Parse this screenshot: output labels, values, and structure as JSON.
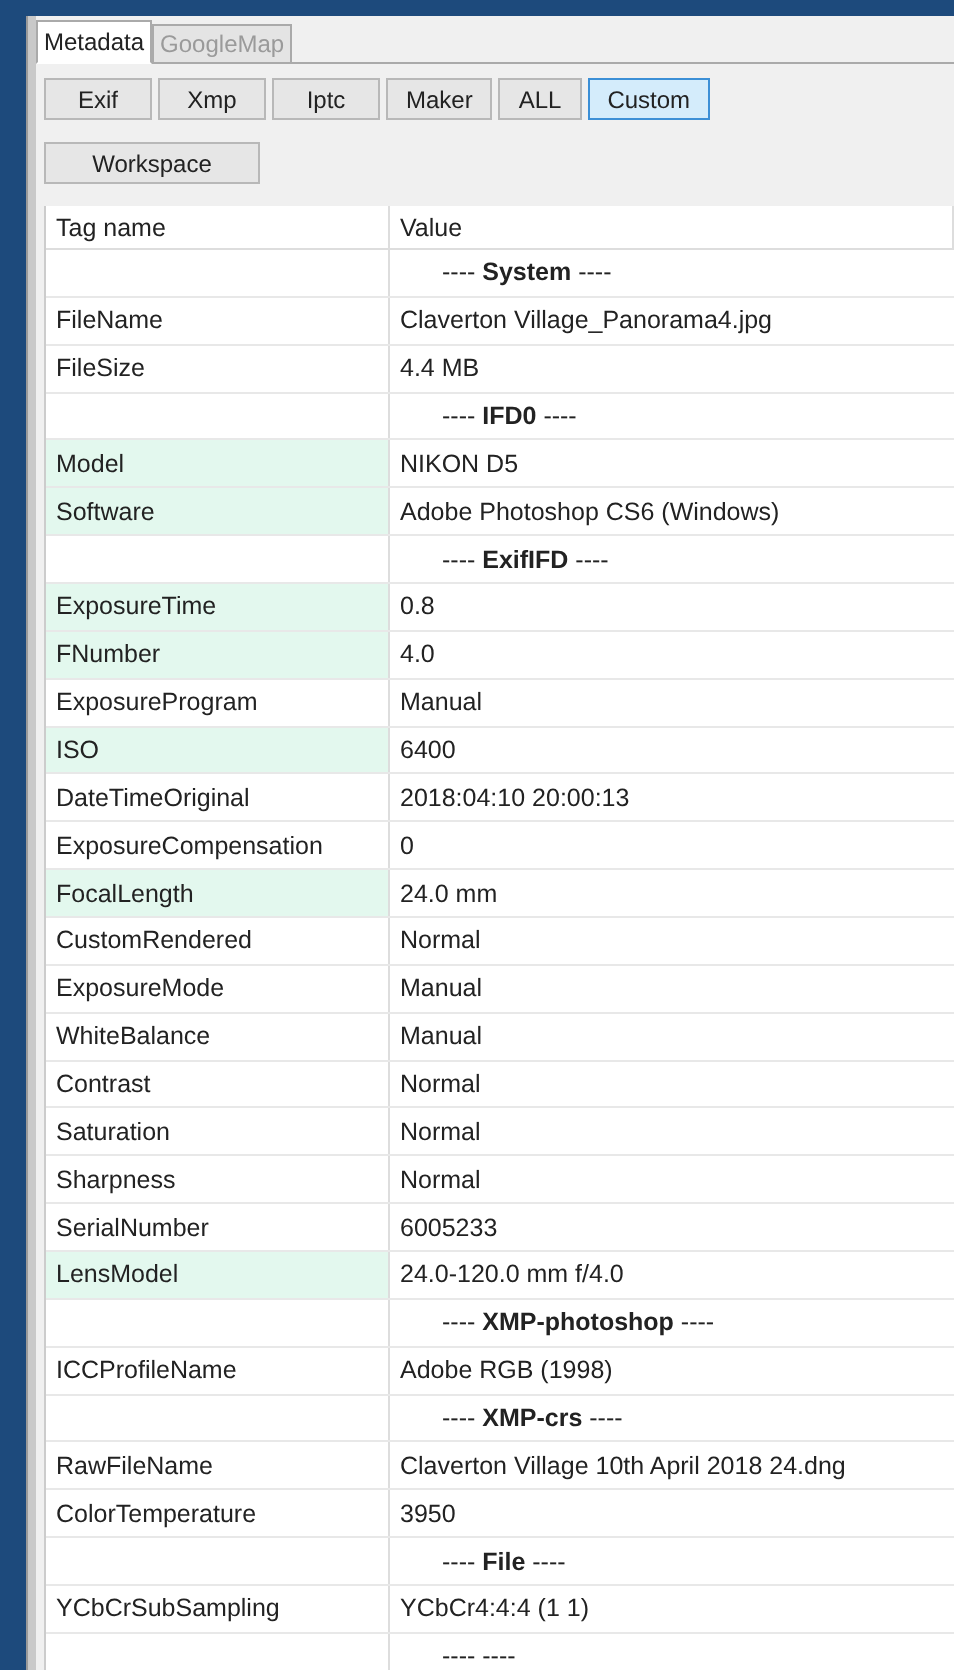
{
  "tabs": [
    {
      "label": "Metadata",
      "selected": true
    },
    {
      "label": "GoogleMap",
      "selected": false
    }
  ],
  "filter_buttons": [
    {
      "label": "Exif",
      "selected": false
    },
    {
      "label": "Xmp",
      "selected": false
    },
    {
      "label": "Iptc",
      "selected": false
    },
    {
      "label": "Maker",
      "selected": false
    },
    {
      "label": "ALL",
      "selected": false
    },
    {
      "label": "Custom",
      "selected": true
    }
  ],
  "workspace_button": "Workspace",
  "table": {
    "columns": [
      "Tag name",
      "Value"
    ],
    "rows": [
      {
        "kind": "section",
        "value": "---- **System** ----"
      },
      {
        "kind": "tag",
        "name": "FileName",
        "value": "Claverton Village_Panorama4.jpg",
        "highlighted": false
      },
      {
        "kind": "tag",
        "name": "FileSize",
        "value": "4.4 MB",
        "highlighted": false
      },
      {
        "kind": "section",
        "value": "---- **IFD0** ----"
      },
      {
        "kind": "tag",
        "name": "Model",
        "value": "NIKON D5",
        "highlighted": true
      },
      {
        "kind": "tag",
        "name": "Software",
        "value": "Adobe Photoshop CS6 (Windows)",
        "highlighted": true
      },
      {
        "kind": "section",
        "value": "---- **ExifIFD** ----"
      },
      {
        "kind": "tag",
        "name": "ExposureTime",
        "value": "0.8",
        "highlighted": true
      },
      {
        "kind": "tag",
        "name": "FNumber",
        "value": "4.0",
        "highlighted": true
      },
      {
        "kind": "tag",
        "name": "ExposureProgram",
        "value": "Manual",
        "highlighted": false
      },
      {
        "kind": "tag",
        "name": "ISO",
        "value": "6400",
        "highlighted": true
      },
      {
        "kind": "tag",
        "name": "DateTimeOriginal",
        "value": "2018:04:10 20:00:13",
        "highlighted": false
      },
      {
        "kind": "tag",
        "name": "ExposureCompensation",
        "value": "0",
        "highlighted": false
      },
      {
        "kind": "tag",
        "name": "FocalLength",
        "value": "24.0 mm",
        "highlighted": true
      },
      {
        "kind": "tag",
        "name": "CustomRendered",
        "value": "Normal",
        "highlighted": false
      },
      {
        "kind": "tag",
        "name": "ExposureMode",
        "value": "Manual",
        "highlighted": false
      },
      {
        "kind": "tag",
        "name": "WhiteBalance",
        "value": "Manual",
        "highlighted": false
      },
      {
        "kind": "tag",
        "name": "Contrast",
        "value": "Normal",
        "highlighted": false
      },
      {
        "kind": "tag",
        "name": "Saturation",
        "value": "Normal",
        "highlighted": false
      },
      {
        "kind": "tag",
        "name": "Sharpness",
        "value": "Normal",
        "highlighted": false
      },
      {
        "kind": "tag",
        "name": "SerialNumber",
        "value": "6005233",
        "highlighted": false
      },
      {
        "kind": "tag",
        "name": "LensModel",
        "value": "24.0-120.0 mm f/4.0",
        "highlighted": true
      },
      {
        "kind": "section",
        "value": "---- **XMP-photoshop** ----"
      },
      {
        "kind": "tag",
        "name": "ICCProfileName",
        "value": "Adobe RGB (1998)",
        "highlighted": false
      },
      {
        "kind": "section",
        "value": "---- **XMP-crs** ----"
      },
      {
        "kind": "tag",
        "name": "RawFileName",
        "value": "Claverton Village 10th April 2018 24.dng",
        "highlighted": false
      },
      {
        "kind": "tag",
        "name": "ColorTemperature",
        "value": "3950",
        "highlighted": false
      },
      {
        "kind": "section",
        "value": "---- **File** ----"
      },
      {
        "kind": "tag",
        "name": "YCbCrSubSampling",
        "value": "YCbCr4:4:4 (1 1)",
        "highlighted": false
      },
      {
        "kind": "section",
        "value": "----  ----"
      }
    ]
  }
}
